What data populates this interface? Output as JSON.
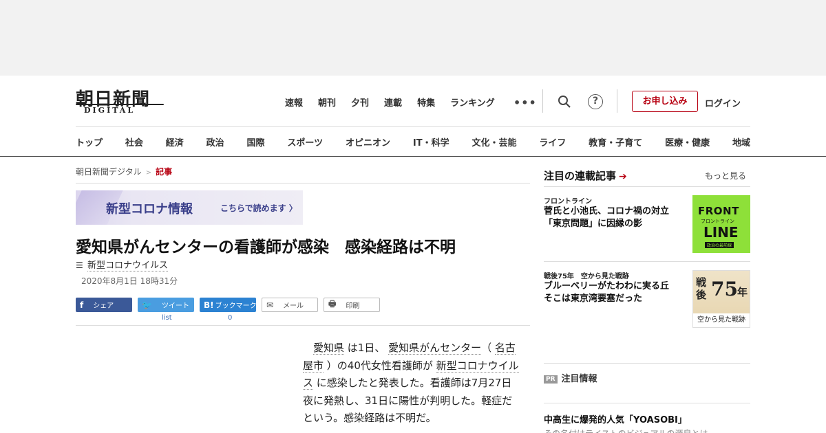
{
  "header": {
    "logo_jp": "朝日新聞",
    "logo_en": "DIGITAL",
    "top_nav": [
      "速報",
      "朝刊",
      "夕刊",
      "連載",
      "特集",
      "ランキング"
    ],
    "more": "•••",
    "help": "?",
    "apply_label": "お申し込み",
    "login_label": "ログイン"
  },
  "categories": [
    "トップ",
    "社会",
    "経済",
    "政治",
    "国際",
    "スポーツ",
    "オピニオン",
    "IT・科学",
    "文化・芸能",
    "ライフ",
    "教育・子育て",
    "医療・健康",
    "地域"
  ],
  "breadcrumb": {
    "home": "朝日新聞デジタル",
    "separator": ">",
    "current": "記事"
  },
  "banner": {
    "title": "新型コロナ情報",
    "cta": "こちらで読めます 〉"
  },
  "article": {
    "headline": "愛知県がんセンターの看護師が感染　感染経路は不明",
    "topic": "新型コロナウイルス",
    "date": "2020年8月1日 18時31分",
    "body": {
      "p1": "愛知県",
      "p2": " は1日、 ",
      "p3": "愛知県がんセンター",
      "p4": "（ ",
      "p5": "名古屋市",
      "p6": " ）の40代女性看護師が ",
      "p7": "新型コロナウイルス",
      "p8": " に感染したと発表した。看護師は7月27日夜に発熱し、31日に陽性が判明した。軽症だという。感染経路は不明だ。"
    }
  },
  "share": {
    "facebook": "シェア",
    "twitter": "ツイート",
    "hatena": "ブックマーク",
    "mail": "メール",
    "print": "印刷",
    "twitter_count": "list",
    "hatena_count": "0"
  },
  "sidebar": {
    "title": "注目の連載記事",
    "more": "もっと見る",
    "items": [
      {
        "series": "フロントライン",
        "title": "菅氏と小池氏、コロナ禍の対立「東京問題」に因縁の影"
      },
      {
        "series": "戦後75年　空から見た戦跡",
        "title": "ブルーベリーがたわわに実る丘　そこは東京湾要塞だった"
      }
    ],
    "thumb1": {
      "line1": "FRONT",
      "line2": "LINE",
      "sub": "フロントライン",
      "tag": "政治の最前線"
    },
    "thumb2": {
      "a": "戦後",
      "b": "75",
      "c": "年",
      "caption": "空から見た戦跡"
    },
    "pr_badge": "PR",
    "pr_title": "注目情報",
    "pr_headline": "中高生に爆発的人気「YOASOBI」",
    "pr_sub": "その名付けテイストのビジュアルの源泉とは"
  }
}
